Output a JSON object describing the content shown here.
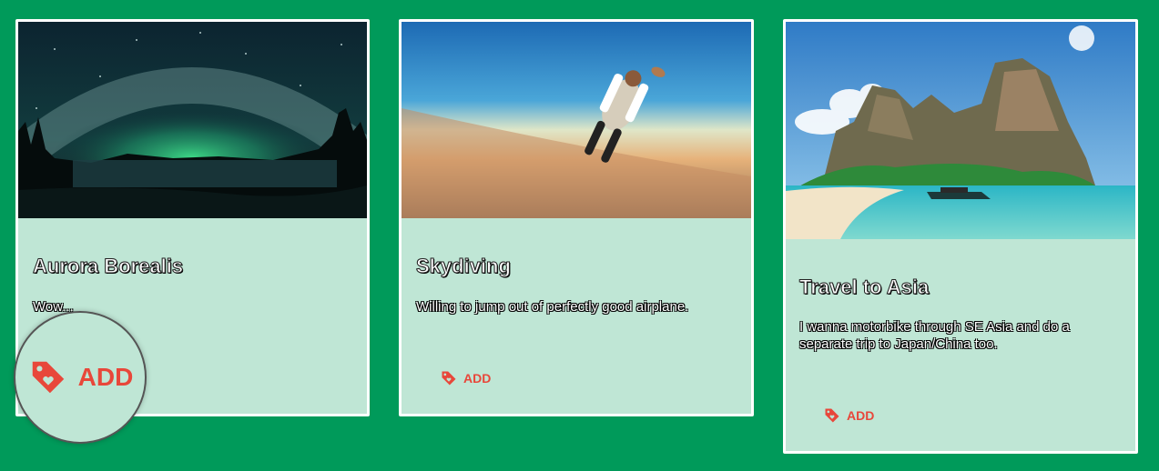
{
  "colors": {
    "background": "#009a5a",
    "card": "#bfe6d5",
    "accent": "#e8473a"
  },
  "cards": [
    {
      "title": "Aurora Borealis",
      "description": "Wow...",
      "button_label": "ADD",
      "icon": "tag-heart-icon"
    },
    {
      "title": "Skydiving",
      "description": "Willing to jump out of perfectly good airplane.",
      "button_label": "ADD",
      "icon": "tag-heart-icon"
    },
    {
      "title": "Travel to Asia",
      "description": "I wanna motorbike through SE Asia and do a separate trip to Japan/China too.",
      "button_label": "ADD",
      "icon": "tag-heart-icon"
    }
  ],
  "magnifier": {
    "label": "ADD",
    "icon": "tag-heart-icon"
  }
}
